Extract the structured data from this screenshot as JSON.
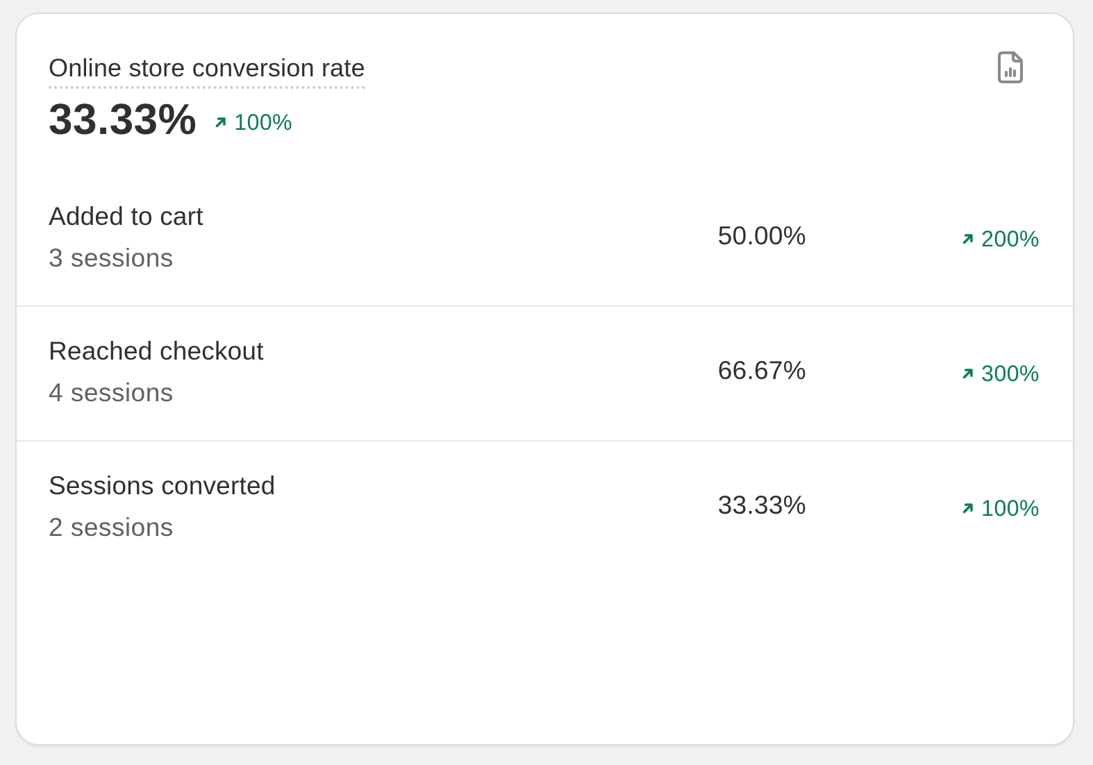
{
  "card": {
    "title": "Online store conversion rate",
    "value": "33.33%",
    "change": "100%",
    "report_icon": "chart-report-icon",
    "trend_icon": "arrow-up-right-icon",
    "trend_color": "#0a7c59"
  },
  "rows": [
    {
      "label": "Added to cart",
      "sessions": "3 sessions",
      "rate": "50.00%",
      "change": "200%"
    },
    {
      "label": "Reached checkout",
      "sessions": "4 sessions",
      "rate": "66.67%",
      "change": "300%"
    },
    {
      "label": "Sessions converted",
      "sessions": "2 sessions",
      "rate": "33.33%",
      "change": "100%"
    }
  ]
}
